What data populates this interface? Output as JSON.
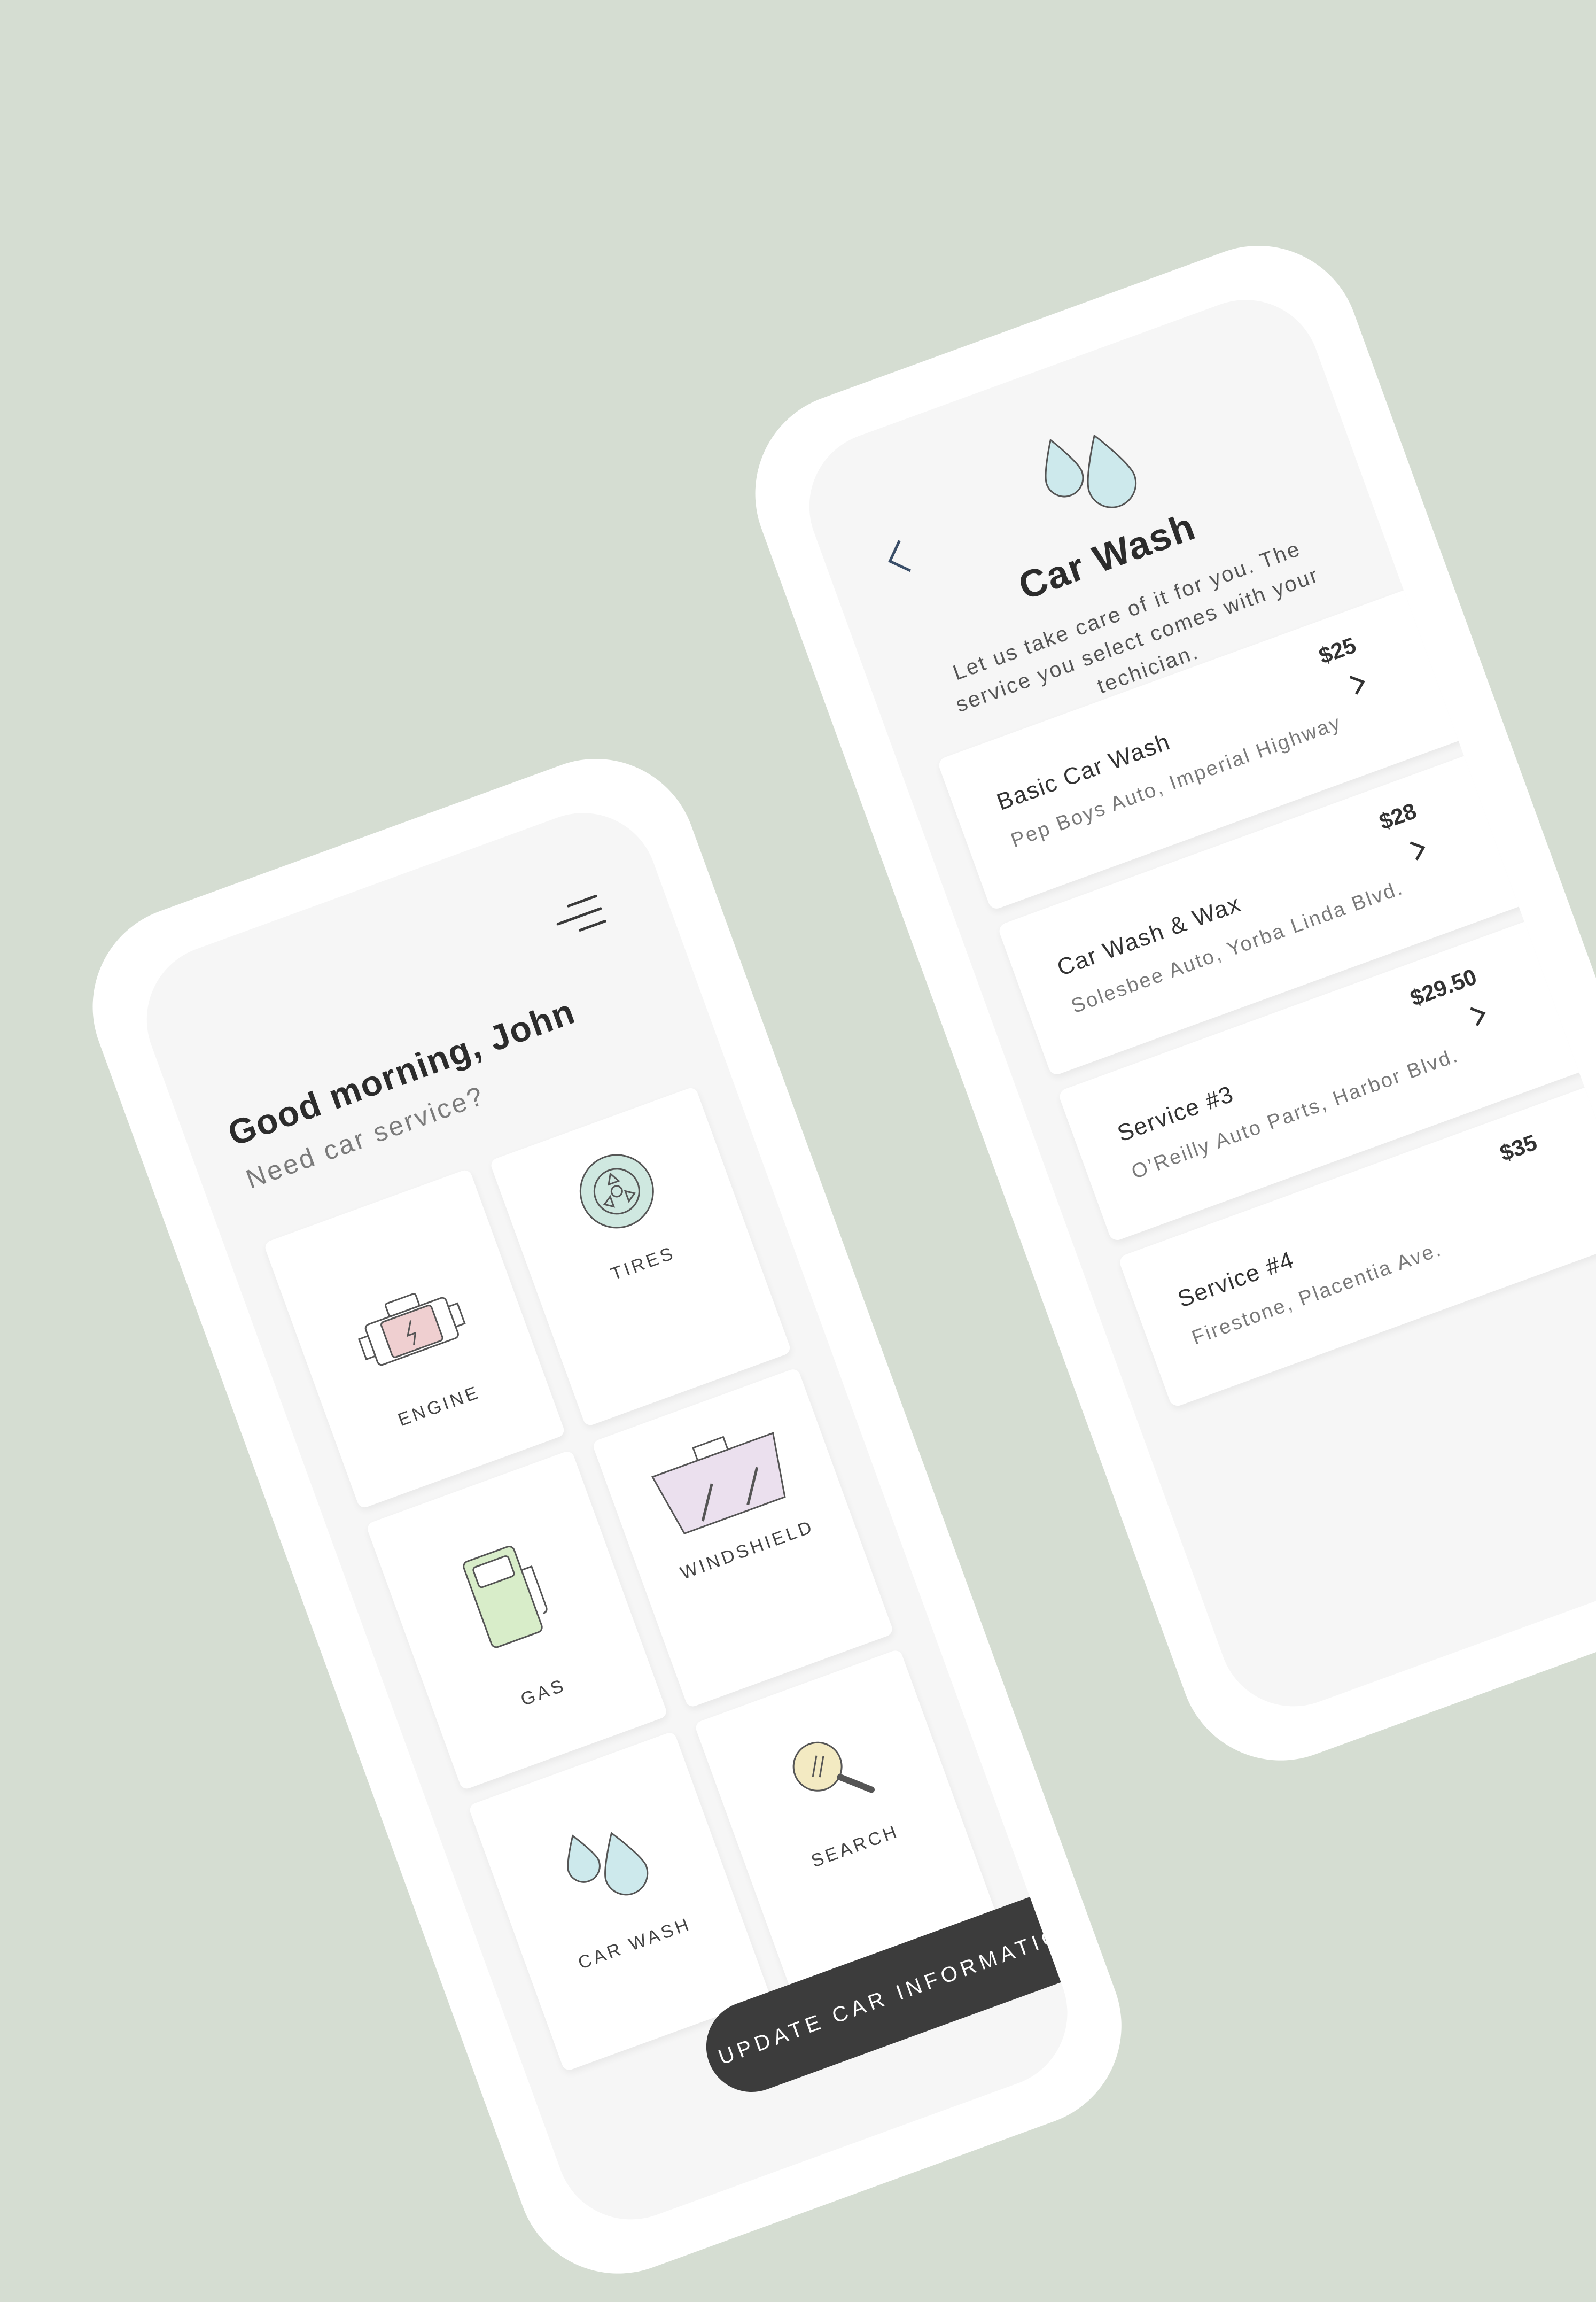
{
  "home": {
    "greeting": "Good morning, John",
    "subtitle": "Need car service?",
    "tiles": [
      {
        "label": "ENGINE",
        "icon": "engine-icon",
        "color": "#efcfd0"
      },
      {
        "label": "TIRES",
        "icon": "tire-icon",
        "color": "#cfe8e0"
      },
      {
        "label": "GAS",
        "icon": "gas-pump-icon",
        "color": "#d8edc9"
      },
      {
        "label": "WINDSHIELD",
        "icon": "windshield-icon",
        "color": "#ebe0ee"
      },
      {
        "label": "CAR WASH",
        "icon": "water-drops-icon",
        "color": "#cde9ec"
      },
      {
        "label": "SEARCH",
        "icon": "magnifier-icon",
        "color": "#f3eac2"
      }
    ],
    "cta_label": "UPDATE CAR INFORMATION"
  },
  "detail": {
    "title": "Car Wash",
    "subtitle": "Let us take care of it for you. The service you select comes with your techician.",
    "services": [
      {
        "title": "Basic Car Wash",
        "location": "Pep Boys Auto, Imperial Highway",
        "price": "$25"
      },
      {
        "title": "Car Wash & Wax",
        "location": "Solesbee Auto, Yorba Linda Blvd.",
        "price": "$28"
      },
      {
        "title": "Service #3",
        "location": "O’Reilly Auto Parts, Harbor Blvd.",
        "price": "$29.50"
      },
      {
        "title": "Service #4",
        "location": "Firestone, Placentia Ave.",
        "price": "$35"
      }
    ]
  },
  "colors": {
    "background": "#d5ddd2",
    "button": "#3c3c3c",
    "drop": "#cde9ec"
  }
}
